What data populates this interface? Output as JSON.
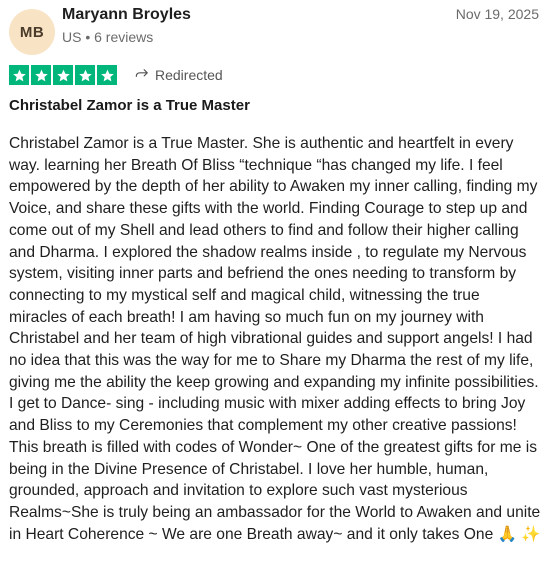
{
  "reviewer": {
    "initials": "MB",
    "name": "Maryann Broyles",
    "meta": "US • 6 reviews"
  },
  "review": {
    "date": "Nov 19, 2025",
    "rating": 5,
    "rating_color": "#00b67a",
    "status_icon": "redirect-arrow-icon",
    "status_label": "Redirected",
    "title": "Christabel Zamor is a True Master",
    "body": "Christabel Zamor is a True Master. She is authentic and heartfelt in every way. learning her Breath Of Bliss “technique “has changed my life. I feel empowered by the depth of her ability to Awaken my inner calling, finding my Voice, and share these gifts with the world. Finding Courage to step up and come out of my Shell and lead others to find and follow their higher calling and Dharma. I explored the shadow realms inside , to regulate my Nervous system, visiting inner parts and befriend the ones needing to transform by connecting to my mystical self and magical child, witnessing the true miracles of each breath! I am having so much fun on my journey with Christabel and her team of high vibrational guides and support angels! I had no idea that this was the way for me to Share my Dharma the rest of my life, giving me the ability the keep growing and expanding my infinite possibilities. I get to Dance- sing - including music with mixer adding effects to bring Joy and Bliss to my Ceremonies that complement my other creative passions! This breath is filled with codes of Wonder~ One of the greatest gifts for me is being in the Divine Presence of Christabel. I love her humble, human, grounded, approach and invitation to explore such vast mysterious Realms~She is truly being an ambassador for the World to Awaken and unite in Heart Coherence ~ We are one Breath away~ and it only takes One 🙏 ✨"
  }
}
